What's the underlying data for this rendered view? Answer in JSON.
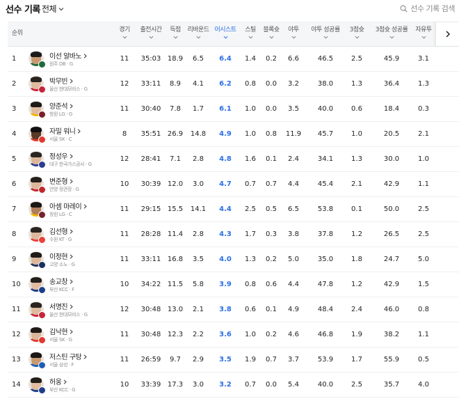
{
  "page": {
    "title": "선수 기록",
    "filter_label": "전체",
    "search_placeholder": "선수 기록 검색"
  },
  "columns": [
    {
      "key": "rank",
      "label": "순위"
    },
    {
      "key": "games",
      "label": "경기"
    },
    {
      "key": "minutes",
      "label": "출전시간"
    },
    {
      "key": "points",
      "label": "득점"
    },
    {
      "key": "rebounds",
      "label": "리바운드"
    },
    {
      "key": "assists",
      "label": "어시스트",
      "active": true
    },
    {
      "key": "steals",
      "label": "스틸"
    },
    {
      "key": "blocks",
      "label": "블록슛"
    },
    {
      "key": "fg",
      "label": "야투"
    },
    {
      "key": "fg_pct",
      "label": "야투 성공률"
    },
    {
      "key": "three",
      "label": "3점슛"
    },
    {
      "key": "three_pct",
      "label": "3점슛 성공률"
    },
    {
      "key": "ft",
      "label": "자유투"
    }
  ],
  "colors": {
    "accent": "#2a6ee8",
    "header_bg": "#f5f6f8"
  },
  "players": [
    {
      "rank": "1",
      "name": "이선 알바노",
      "team": "원주 DB · G",
      "games": "11",
      "minutes": "35:03",
      "points": "18.9",
      "rebounds": "6.5",
      "assists": "6.4",
      "steals": "1.4",
      "blocks": "0.2",
      "fg": "6.6",
      "fg_pct": "46.5",
      "three": "2.5",
      "three_pct": "45.9",
      "ft": "3.1",
      "skin": "#c99a72",
      "hair": "#1b1b1b",
      "shirt": "#1e6b3a",
      "badge": "#1e6b3a"
    },
    {
      "rank": "2",
      "name": "박무빈",
      "team": "울산 현대모비스 · G",
      "games": "12",
      "minutes": "33:11",
      "points": "8.9",
      "rebounds": "4.1",
      "assists": "6.2",
      "steals": "0.8",
      "blocks": "0.0",
      "fg": "3.2",
      "fg_pct": "38.0",
      "three": "1.3",
      "three_pct": "36.4",
      "ft": "1.3",
      "skin": "#e0bba0",
      "hair": "#2a2320",
      "shirt": "#c8243a",
      "badge": "#c8243a"
    },
    {
      "rank": "3",
      "name": "양준석",
      "team": "창원 LG · G",
      "games": "11",
      "minutes": "30:40",
      "points": "7.8",
      "rebounds": "1.7",
      "assists": "6.1",
      "steals": "1.0",
      "blocks": "0.0",
      "fg": "3.5",
      "fg_pct": "40.0",
      "three": "0.6",
      "three_pct": "18.4",
      "ft": "0.3",
      "skin": "#e0bba0",
      "hair": "#1d1a18",
      "shirt": "#f2b600",
      "badge": "#7a1f2b"
    },
    {
      "rank": "4",
      "name": "자밀 워니",
      "team": "서울 SK · C",
      "games": "8",
      "minutes": "35:51",
      "points": "26.9",
      "rebounds": "14.8",
      "assists": "4.9",
      "steals": "1.0",
      "blocks": "0.8",
      "fg": "11.9",
      "fg_pct": "45.7",
      "three": "1.0",
      "three_pct": "20.5",
      "ft": "2.1",
      "skin": "#5a3a26",
      "hair": "#111111",
      "shirt": "#e03a2f",
      "badge": "#e03a2f"
    },
    {
      "rank": "5",
      "name": "정성우",
      "team": "대구 한국가스공사 · G",
      "games": "12",
      "minutes": "28:41",
      "points": "7.1",
      "rebounds": "2.8",
      "assists": "4.8",
      "steals": "1.6",
      "blocks": "0.1",
      "fg": "2.4",
      "fg_pct": "34.1",
      "three": "1.3",
      "three_pct": "30.0",
      "ft": "1.0",
      "skin": "#dcb59a",
      "hair": "#2b2521",
      "shirt": "#2c3e8f",
      "badge": "#2c3e8f"
    },
    {
      "rank": "6",
      "name": "변준형",
      "team": "안양 정관장 · G",
      "games": "10",
      "minutes": "30:39",
      "points": "12.0",
      "rebounds": "3.0",
      "assists": "4.7",
      "steals": "0.7",
      "blocks": "0.7",
      "fg": "4.4",
      "fg_pct": "45.4",
      "three": "2.1",
      "three_pct": "42.9",
      "ft": "1.1",
      "skin": "#ddb79c",
      "hair": "#231f1c",
      "shirt": "#c0272d",
      "badge": "#c0272d"
    },
    {
      "rank": "7",
      "name": "아셈 마레이",
      "team": "창원 LG · C",
      "games": "11",
      "minutes": "29:15",
      "points": "15.5",
      "rebounds": "14.1",
      "assists": "4.4",
      "steals": "2.5",
      "blocks": "0.5",
      "fg": "6.5",
      "fg_pct": "53.8",
      "three": "0.1",
      "three_pct": "50.0",
      "ft": "2.5",
      "skin": "#b07d5a",
      "hair": "#1a1715",
      "shirt": "#f2b600",
      "badge": "#7a1f2b"
    },
    {
      "rank": "8",
      "name": "김선형",
      "team": "수원 KT · G",
      "games": "11",
      "minutes": "28:28",
      "points": "11.4",
      "rebounds": "2.8",
      "assists": "4.3",
      "steals": "1.7",
      "blocks": "0.3",
      "fg": "3.8",
      "fg_pct": "37.8",
      "three": "1.2",
      "three_pct": "26.5",
      "ft": "2.5",
      "skin": "#dfb99e",
      "hair": "#2a2420",
      "shirt": "#e8423a",
      "badge": "#e8423a"
    },
    {
      "rank": "9",
      "name": "이정현",
      "team": "고양 소노 · G",
      "games": "11",
      "minutes": "33:11",
      "points": "16.8",
      "rebounds": "3.5",
      "assists": "4.0",
      "steals": "1.3",
      "blocks": "0.2",
      "fg": "5.0",
      "fg_pct": "35.0",
      "three": "1.8",
      "three_pct": "24.7",
      "ft": "5.0",
      "skin": "#dcb69b",
      "hair": "#1f1b19",
      "shirt": "#1c2f5e",
      "badge": "#1c2f5e"
    },
    {
      "rank": "10",
      "name": "송교창",
      "team": "부산 KCC · F",
      "games": "10",
      "minutes": "34:22",
      "points": "11.5",
      "rebounds": "5.8",
      "assists": "3.9",
      "steals": "0.8",
      "blocks": "0.6",
      "fg": "4.4",
      "fg_pct": "47.8",
      "three": "1.2",
      "three_pct": "42.9",
      "ft": "1.5",
      "skin": "#e0bca1",
      "hair": "#221e1b",
      "shirt": "#1d3f8a",
      "badge": "#1d3f8a"
    },
    {
      "rank": "11",
      "name": "서명진",
      "team": "울산 현대모비스 · G",
      "games": "12",
      "minutes": "30:48",
      "points": "13.0",
      "rebounds": "2.1",
      "assists": "3.8",
      "steals": "0.6",
      "blocks": "0.1",
      "fg": "4.9",
      "fg_pct": "48.4",
      "three": "2.4",
      "three_pct": "46.0",
      "ft": "0.8",
      "skin": "#dfba9f",
      "hair": "#2a2420",
      "shirt": "#c8243a",
      "badge": "#c8243a"
    },
    {
      "rank": "12",
      "name": "김낙현",
      "team": "서울 SK · G",
      "games": "11",
      "minutes": "30:48",
      "points": "12.3",
      "rebounds": "2.2",
      "assists": "3.6",
      "steals": "1.0",
      "blocks": "0.2",
      "fg": "4.6",
      "fg_pct": "46.8",
      "three": "1.9",
      "three_pct": "38.2",
      "ft": "1.1",
      "skin": "#dcb69b",
      "hair": "#1e1a18",
      "shirt": "#e03a2f",
      "badge": "#e03a2f"
    },
    {
      "rank": "13",
      "name": "저스틴 구탕",
      "team": "서울 삼성 · F",
      "games": "11",
      "minutes": "26:59",
      "points": "9.7",
      "rebounds": "2.9",
      "assists": "3.5",
      "steals": "1.9",
      "blocks": "0.7",
      "fg": "3.7",
      "fg_pct": "53.9",
      "three": "1.7",
      "three_pct": "55.9",
      "ft": "0.5",
      "skin": "#c9996f",
      "hair": "#1a1715",
      "shirt": "#1e5fb5",
      "badge": "#1e5fb5"
    },
    {
      "rank": "14",
      "name": "허웅",
      "team": "부산 KCC · G",
      "games": "10",
      "minutes": "33:39",
      "points": "17.3",
      "rebounds": "3.0",
      "assists": "3.2",
      "steals": "0.7",
      "blocks": "0.0",
      "fg": "5.4",
      "fg_pct": "40.0",
      "three": "2.5",
      "three_pct": "35.7",
      "ft": "4.0",
      "skin": "#e0bca1",
      "hair": "#221e1b",
      "shirt": "#1d3f8a",
      "badge": "#1d3f8a"
    }
  ]
}
